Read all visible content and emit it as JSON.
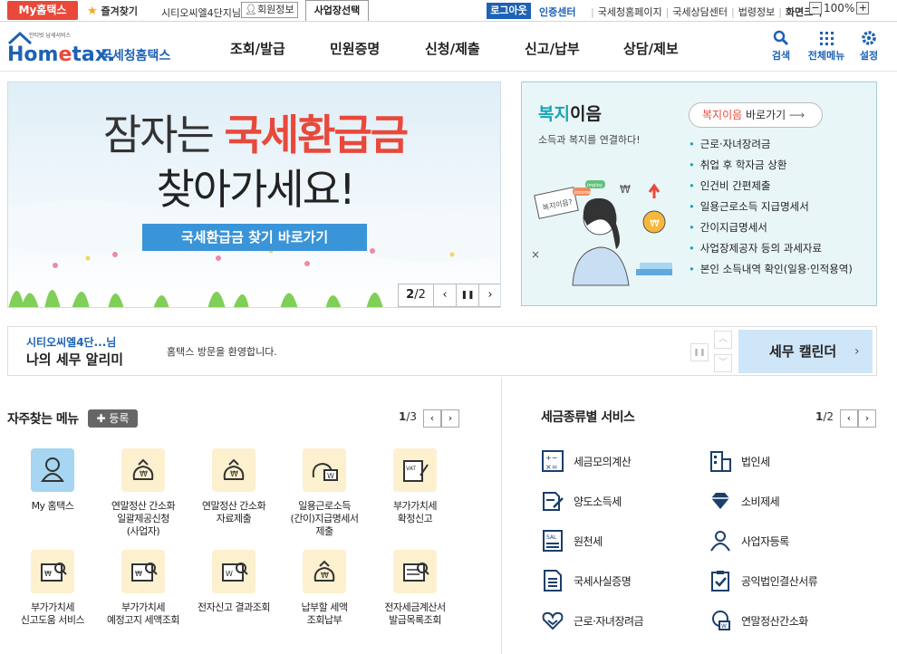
{
  "topbar": {
    "myhome": "My홈택스",
    "favorites": "즐겨찾기",
    "username": "시티오씨엘4단지님",
    "member_info": "회원정보",
    "biz_select": "사업장선택",
    "logout": "로그아웃",
    "cert_center": "인증센터",
    "links": [
      "국세청홈페이지",
      "국세상담센터",
      "법령정보"
    ],
    "screen_size": "화면크기",
    "zoom": "100%",
    "zoom_minus": "−",
    "zoom_plus": "+"
  },
  "header": {
    "logo_small": "안티빗 납세서비스",
    "logo_main": "Hometax",
    "logo_sub": "국세청홈택스",
    "nav": [
      "조회/발급",
      "민원증명",
      "신청/제출",
      "신고/납부",
      "상담/제보"
    ],
    "icons": [
      {
        "label": "검색",
        "icon": "search-icon"
      },
      {
        "label": "전체메뉴",
        "icon": "grid-menu-icon"
      },
      {
        "label": "설정",
        "icon": "gear-icon"
      }
    ]
  },
  "banner": {
    "line1_prefix": "잠자는",
    "line1_highlight": "국세환급금",
    "line2": "찾아가세요!",
    "button": "국세환급금 찾기 바로가기",
    "page_current": "2",
    "page_total": "/2",
    "prev": "‹",
    "pause": "❚❚",
    "next": "›"
  },
  "welfare": {
    "title_a": "복지",
    "title_b": "이음",
    "subtitle": "소득과 복지를 연결하다!",
    "link_a": "복지이음",
    "link_b": "바로가기",
    "items": [
      "근로·자녀장려금",
      "취업 후 학자금 상환",
      "인건비 간편제출",
      "일용근로소득 지급명세서",
      "간이지급명세서",
      "사업장제공자 등의 과세자료",
      "본인 소득내역 확인(일용·인적용역)"
    ],
    "illus_sign": "복지이음?",
    "illus_tag1": "imploy",
    "illus_tag2": "income"
  },
  "notice": {
    "name": "시티오씨엘4단...님",
    "title": "나의 세무 알리미",
    "message": "홈택스 방문을 환영합니다.",
    "calendar": "세무 캘린더",
    "pause": "❚❚",
    "up": "︿",
    "down": "﹀",
    "cal_arrow": "›"
  },
  "favorites_menu": {
    "title": "자주찾는 메뉴",
    "register": "등록",
    "page": "1",
    "total": "/3",
    "prev": "‹",
    "next": "›",
    "items": [
      {
        "label": "My 홈택스",
        "icon": "user-icon"
      },
      {
        "label": "연말정산 간소화\n일괄제공신청\n(사업자)",
        "icon": "money-bag-icon"
      },
      {
        "label": "연말정산 간소화\n자료제출",
        "icon": "money-bag-icon"
      },
      {
        "label": "일용근로소득\n(간이)지급명세서\n제출",
        "icon": "money-card-icon"
      },
      {
        "label": "부가가치세\n확정신고",
        "icon": "vat-doc-icon"
      },
      {
        "label": "부가가치세\n신고도움 서비스",
        "icon": "tax-doc-search-icon"
      },
      {
        "label": "부가가치세\n예정고지 세액조회",
        "icon": "tax-doc-search-icon"
      },
      {
        "label": "전자신고 결과조회",
        "icon": "won-doc-search-icon"
      },
      {
        "label": "납부할 세액\n조회납부",
        "icon": "money-bag-icon"
      },
      {
        "label": "전자세금계산서\n발급목록조회",
        "icon": "invoice-search-icon"
      }
    ]
  },
  "tax_service": {
    "title": "세금종류별 서비스",
    "page": "1",
    "total": "/2",
    "prev": "‹",
    "next": "›",
    "items": [
      {
        "label": "세금모의계산",
        "icon": "calculator-icon"
      },
      {
        "label": "법인세",
        "icon": "building-icon"
      },
      {
        "label": "양도소득세",
        "icon": "document-pen-icon"
      },
      {
        "label": "소비제세",
        "icon": "diamond-icon"
      },
      {
        "label": "원천세",
        "icon": "salary-doc-icon"
      },
      {
        "label": "사업자등록",
        "icon": "person-icon"
      },
      {
        "label": "국세사실증명",
        "icon": "certificate-icon"
      },
      {
        "label": "공익법인결산서류",
        "icon": "clipboard-check-icon"
      },
      {
        "label": "근로·자녀장려금",
        "icon": "heart-hands-icon"
      },
      {
        "label": "연말정산간소화",
        "icon": "won-hand-icon"
      }
    ]
  },
  "colors": {
    "brand_blue": "#1d62b5",
    "accent_red": "#e8493b",
    "welfare_teal": "#18a3b2",
    "banner_button": "#3a94d8"
  }
}
